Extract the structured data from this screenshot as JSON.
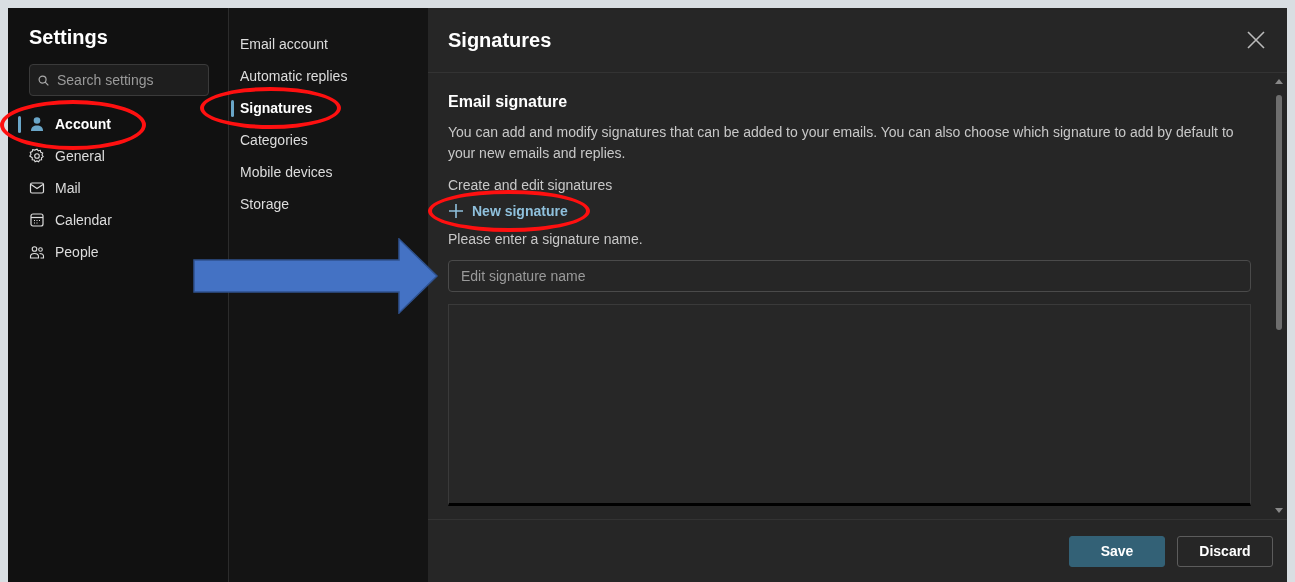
{
  "sidebar": {
    "title": "Settings",
    "search": {
      "placeholder": "Search settings"
    },
    "items": [
      {
        "label": "Account",
        "selected": true,
        "circled": true
      },
      {
        "label": "General",
        "selected": false,
        "circled": false
      },
      {
        "label": "Mail",
        "selected": false,
        "circled": false
      },
      {
        "label": "Calendar",
        "selected": false,
        "circled": false
      },
      {
        "label": "People",
        "selected": false,
        "circled": false
      }
    ]
  },
  "subnav": {
    "items": [
      {
        "label": "Email account",
        "selected": false,
        "circled": false
      },
      {
        "label": "Automatic replies",
        "selected": false,
        "circled": false
      },
      {
        "label": "Signatures",
        "selected": true,
        "circled": true
      },
      {
        "label": "Categories",
        "selected": false,
        "circled": false
      },
      {
        "label": "Mobile devices",
        "selected": false,
        "circled": false
      },
      {
        "label": "Storage",
        "selected": false,
        "circled": false
      }
    ]
  },
  "panel": {
    "title": "Signatures",
    "section_title": "Email signature",
    "description": "You can add and modify signatures that can be added to your emails. You can also choose which signature to add by default to your new emails and replies.",
    "create_label": "Create and edit signatures",
    "new_signature": {
      "label": "New signature",
      "circled": true
    },
    "hint": "Please enter a signature name.",
    "name_field": {
      "placeholder": "Edit signature name",
      "arrow_pointer": true
    },
    "buttons": [
      {
        "label": "Save",
        "kind": "primary"
      },
      {
        "label": "Discard",
        "kind": "secondary"
      }
    ]
  }
}
